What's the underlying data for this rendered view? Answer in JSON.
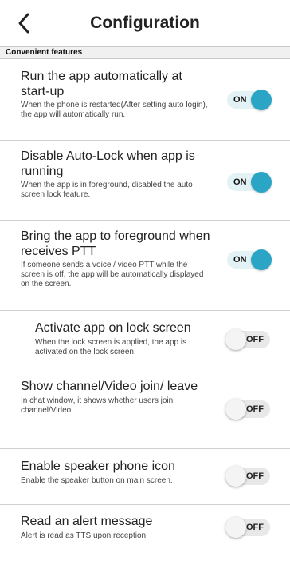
{
  "header": {
    "title": "Configuration",
    "back_icon": "chevron-left-icon"
  },
  "section": {
    "label": "Convenient features"
  },
  "settings": [
    {
      "title": "Run the app automatically at start-up",
      "desc": "When the phone is restarted(After setting auto login), the app will automatically run.",
      "state": "ON"
    },
    {
      "title": "Disable Auto-Lock when app is running",
      "desc": "When the app is in foreground, disabled the auto screen lock feature.",
      "state": "ON"
    },
    {
      "title": "Bring the app to foreground when receives PTT",
      "desc": "If someone sends a voice / video PTT while the screen is off, the app will be automatically displayed on the screen.",
      "state": "ON"
    },
    {
      "title": "Activate app on lock screen",
      "desc": "When the lock screen is applied, the app is activated on the lock screen.",
      "state": "OFF"
    },
    {
      "title": "Show channel/Video join/ leave",
      "desc": "In chat window, it shows whether users join channel/Video.",
      "state": "OFF"
    },
    {
      "title": "Enable speaker phone icon",
      "desc": "Enable the speaker button on main screen.",
      "state": "OFF"
    },
    {
      "title": "Read an alert message",
      "desc": "Alert is read as TTS upon reception.",
      "state": "OFF"
    }
  ],
  "colors": {
    "accent": "#2ba5c5",
    "toggle_on_track": "#e3f2f5",
    "toggle_off_track": "#e8e8e8",
    "section_bg": "#f0f0f0"
  }
}
